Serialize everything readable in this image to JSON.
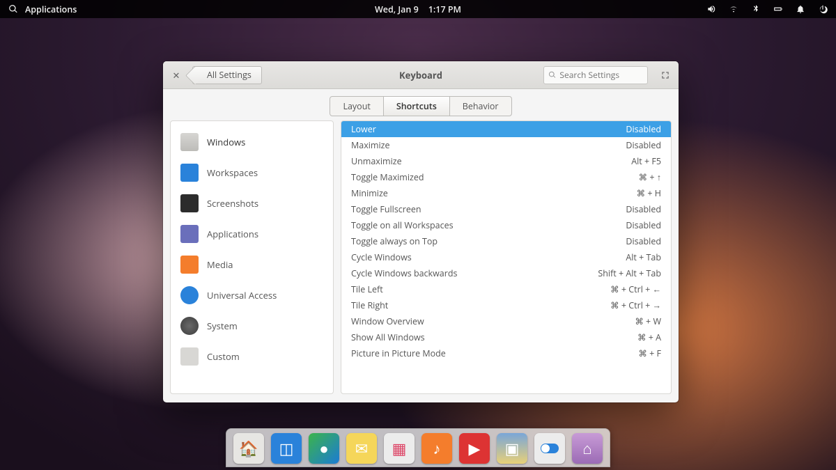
{
  "panel": {
    "applications_label": "Applications",
    "date": "Wed, Jan  9",
    "time": "1:17 PM"
  },
  "window": {
    "back_label": "All Settings",
    "title": "Keyboard",
    "search_placeholder": "Search Settings",
    "tabs": {
      "layout": "Layout",
      "shortcuts": "Shortcuts",
      "behavior": "Behavior"
    }
  },
  "sidebar": [
    {
      "label": "Windows",
      "icon": "ic-windows"
    },
    {
      "label": "Workspaces",
      "icon": "ic-workspaces"
    },
    {
      "label": "Screenshots",
      "icon": "ic-screenshots"
    },
    {
      "label": "Applications",
      "icon": "ic-applications"
    },
    {
      "label": "Media",
      "icon": "ic-media"
    },
    {
      "label": "Universal Access",
      "icon": "ic-ua"
    },
    {
      "label": "System",
      "icon": "ic-system"
    },
    {
      "label": "Custom",
      "icon": "ic-custom"
    }
  ],
  "shortcuts": [
    {
      "name": "Lower",
      "value": "Disabled",
      "selected": true
    },
    {
      "name": "Maximize",
      "value": "Disabled"
    },
    {
      "name": "Unmaximize",
      "value": "Alt + F5"
    },
    {
      "name": "Toggle Maximized",
      "value": "⌘ + ↑"
    },
    {
      "name": "Minimize",
      "value": "⌘ + H"
    },
    {
      "name": "Toggle Fullscreen",
      "value": "Disabled"
    },
    {
      "name": "Toggle on all Workspaces",
      "value": "Disabled"
    },
    {
      "name": "Toggle always on Top",
      "value": "Disabled"
    },
    {
      "name": "Cycle Windows",
      "value": "Alt + Tab"
    },
    {
      "name": "Cycle Windows backwards",
      "value": "Shift + Alt + Tab"
    },
    {
      "name": "Tile Left",
      "value": "⌘ + Ctrl + ←"
    },
    {
      "name": "Tile Right",
      "value": "⌘ + Ctrl + →"
    },
    {
      "name": "Window Overview",
      "value": "⌘ + W"
    },
    {
      "name": "Show All Windows",
      "value": "⌘ + A"
    },
    {
      "name": "Picture in Picture Mode",
      "value": "⌘ + F"
    }
  ],
  "dock": [
    {
      "name": "files",
      "class": "d-files",
      "glyph": "🏠"
    },
    {
      "name": "multitasking",
      "class": "d-multi",
      "glyph": "◫"
    },
    {
      "name": "browser",
      "class": "d-web",
      "glyph": "●"
    },
    {
      "name": "mail",
      "class": "d-mail",
      "glyph": "✉"
    },
    {
      "name": "calendar",
      "class": "d-cal",
      "glyph": "▦"
    },
    {
      "name": "music",
      "class": "d-music",
      "glyph": "♪"
    },
    {
      "name": "videos",
      "class": "d-video",
      "glyph": "▶"
    },
    {
      "name": "photos",
      "class": "d-photo",
      "glyph": "▣"
    },
    {
      "name": "switchboard",
      "class": "d-term",
      "glyph": ""
    },
    {
      "name": "appcenter",
      "class": "d-store",
      "glyph": "⌂"
    }
  ]
}
